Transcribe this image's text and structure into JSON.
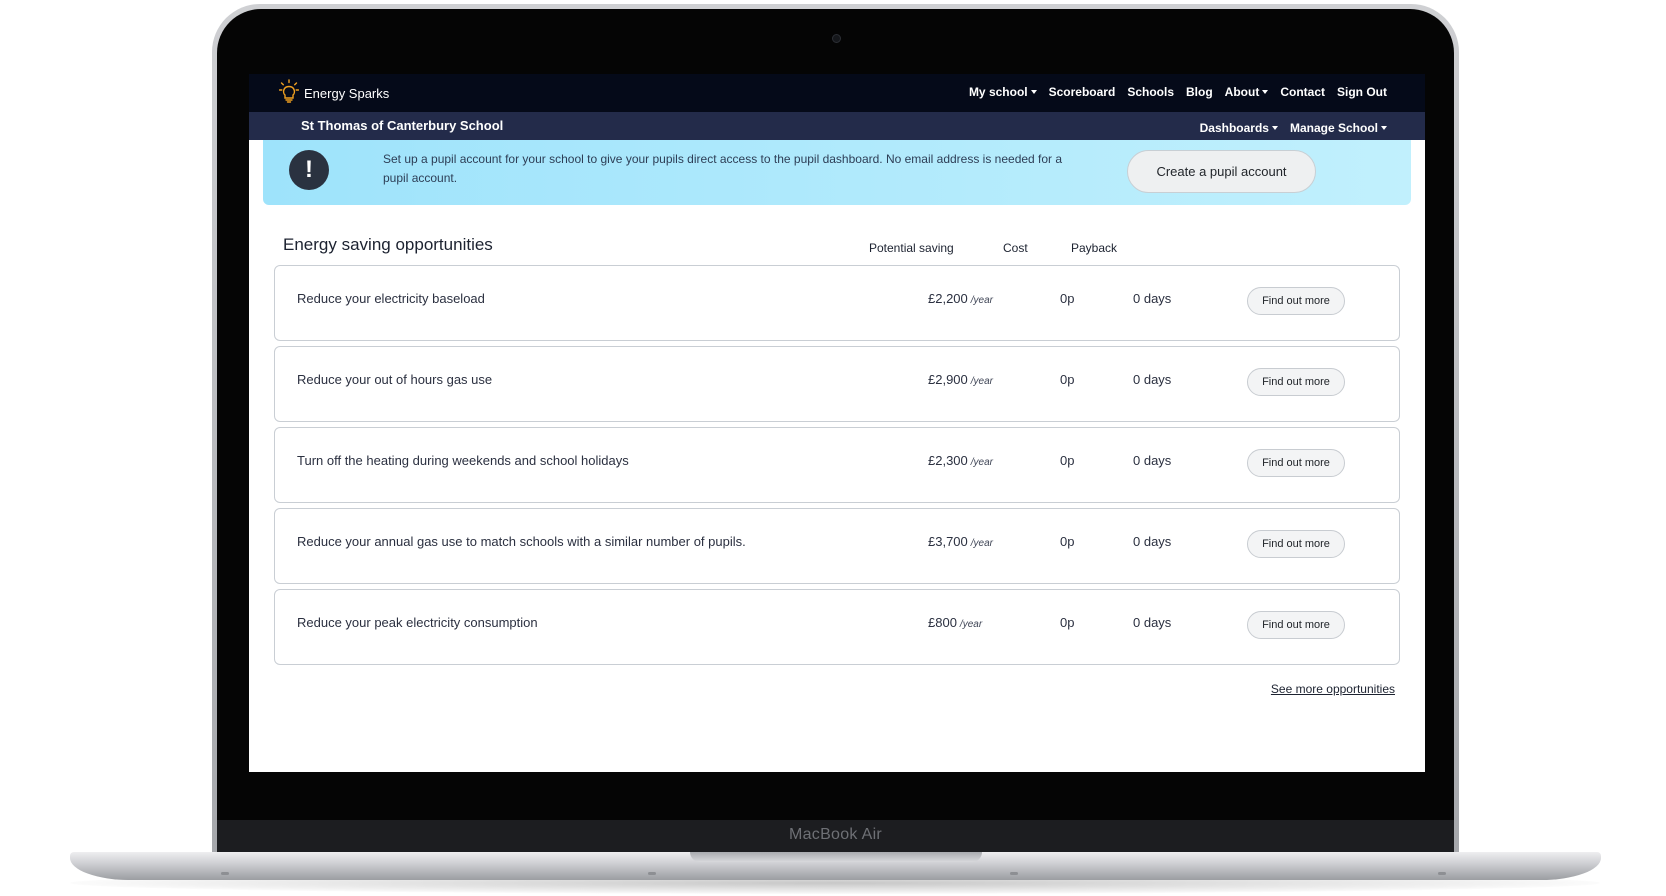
{
  "device": {
    "model_label": "MacBook Air"
  },
  "topnav": {
    "brand": "Energy Sparks",
    "links": [
      {
        "label": "My school",
        "dropdown": true
      },
      {
        "label": "Scoreboard",
        "dropdown": false
      },
      {
        "label": "Schools",
        "dropdown": false
      },
      {
        "label": "Blog",
        "dropdown": false
      },
      {
        "label": "About",
        "dropdown": true
      },
      {
        "label": "Contact",
        "dropdown": false
      },
      {
        "label": "Sign Out",
        "dropdown": false
      }
    ]
  },
  "school_bar": {
    "school_name": "St Thomas of Canterbury School",
    "menus": [
      {
        "label": "Dashboards"
      },
      {
        "label": "Manage School"
      }
    ]
  },
  "alert": {
    "icon": "exclamation-icon",
    "text": "Set up a pupil account for your school to give your pupils direct access to the pupil dashboard. No email address is needed for a pupil account.",
    "button_label": "Create a pupil account"
  },
  "opportunities": {
    "title": "Energy saving opportunities",
    "columns": {
      "saving": "Potential saving",
      "cost": "Cost",
      "payback": "Payback"
    },
    "rows": [
      {
        "title": "Reduce your electricity baseload",
        "saving": "£2,200",
        "unit": "/year",
        "cost": "0p",
        "payback": "0 days",
        "button": "Find out more"
      },
      {
        "title": "Reduce your out of hours gas use",
        "saving": "£2,900",
        "unit": "/year",
        "cost": "0p",
        "payback": "0 days",
        "button": "Find out more"
      },
      {
        "title": "Turn off the heating during weekends and school holidays",
        "saving": "£2,300",
        "unit": "/year",
        "cost": "0p",
        "payback": "0 days",
        "button": "Find out more"
      },
      {
        "title": "Reduce your annual gas use to match schools with a similar number of pupils.",
        "saving": "£3,700",
        "unit": "/year",
        "cost": "0p",
        "payback": "0 days",
        "button": "Find out more"
      },
      {
        "title": "Reduce your peak electricity consumption",
        "saving": "£800",
        "unit": "/year",
        "cost": "0p",
        "payback": "0 days",
        "button": "Find out more"
      }
    ],
    "see_more": "See more opportunities"
  },
  "colors": {
    "nav_bg": "#050a19",
    "school_bar_bg": "#232b4a",
    "alert_bg": "#b3ecfc",
    "brand_icon": "#f0a020"
  }
}
